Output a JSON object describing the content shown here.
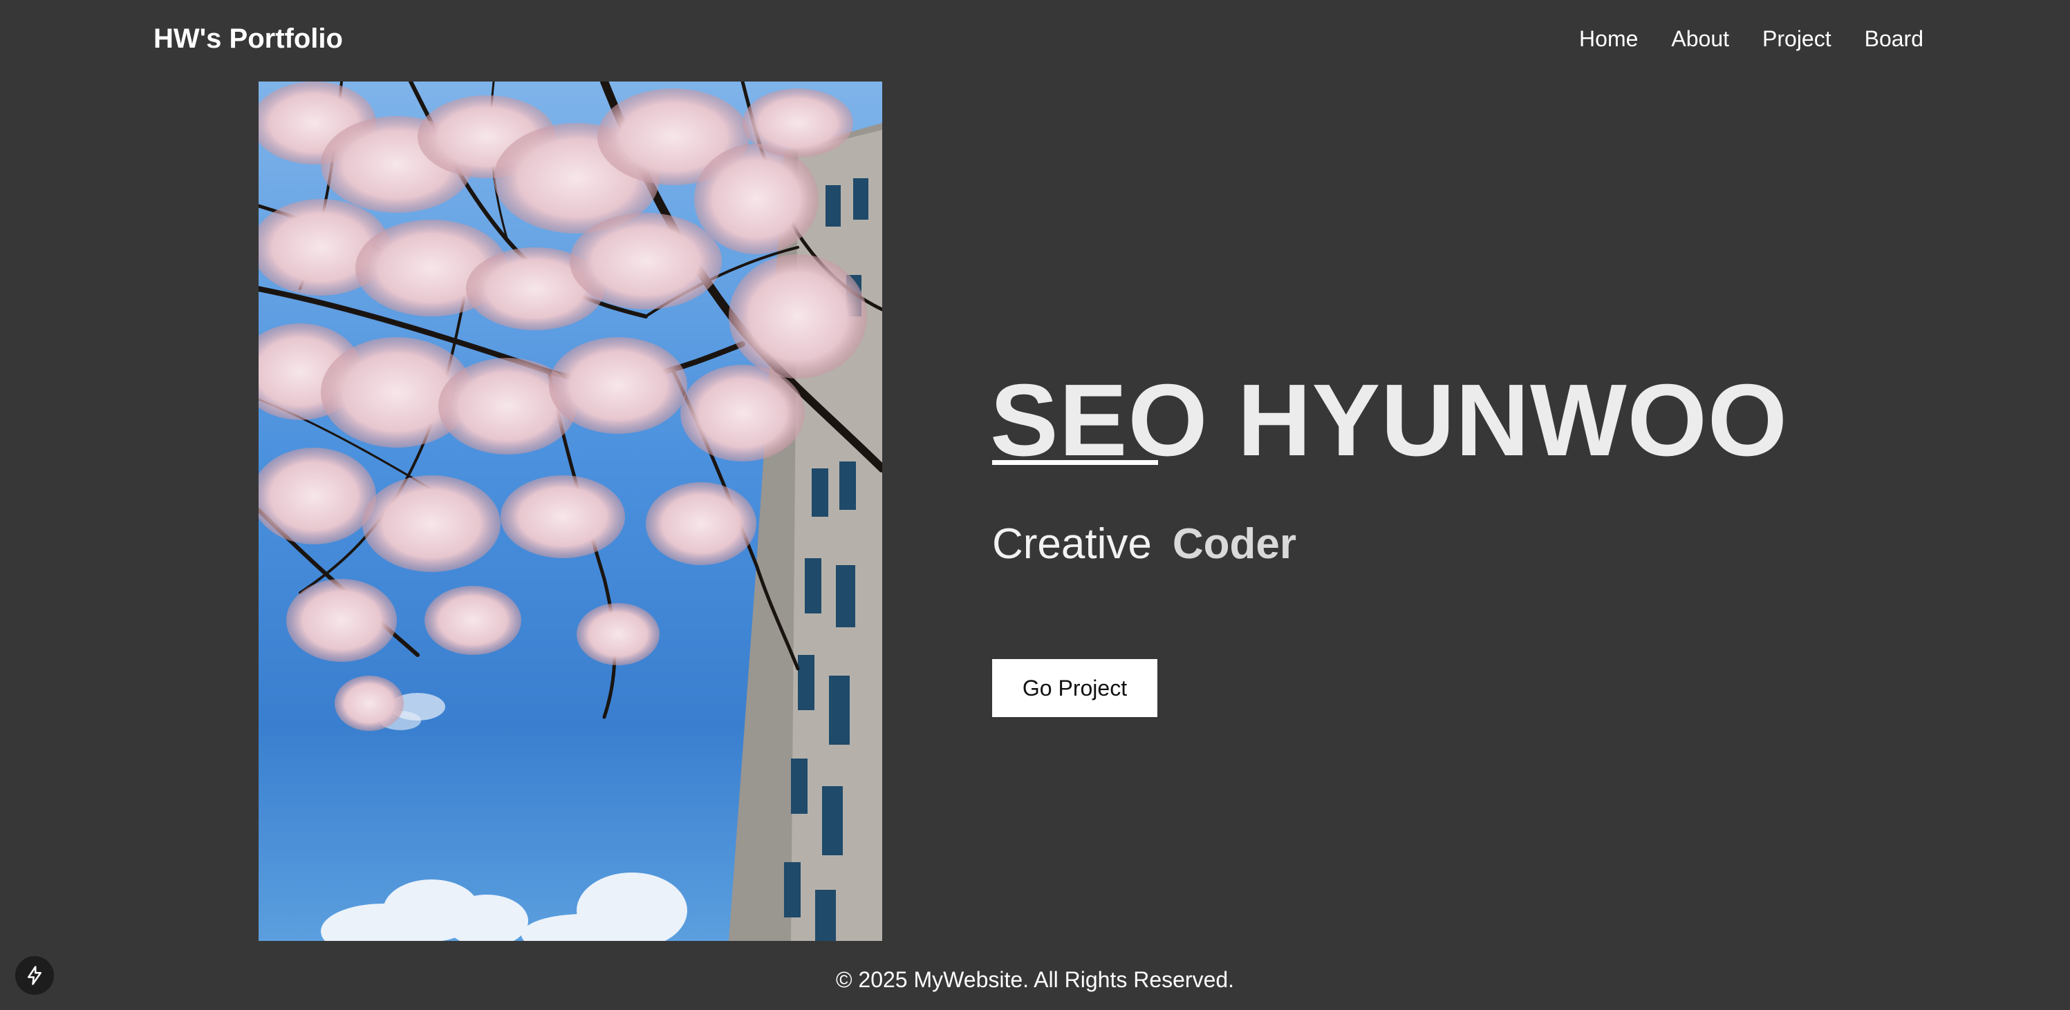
{
  "header": {
    "brand": "HW's Portfolio",
    "nav": [
      {
        "label": "Home"
      },
      {
        "label": "About"
      },
      {
        "label": "Project"
      },
      {
        "label": "Board"
      }
    ]
  },
  "hero": {
    "name": "SEO HYUNWOO",
    "role_word_1": "Creative",
    "role_word_2": "Coder",
    "cta_label": "Go Project",
    "photo_icon": "cherry-blossom-photo"
  },
  "footer": {
    "copyright": "© 2025 MyWebsite. All Rights Reserved."
  },
  "dev_tools": {
    "icon": "lightning-icon"
  },
  "colors": {
    "background": "#373737",
    "text": "#ffffff",
    "hero_name": "#ececec",
    "cta_bg": "#ffffff",
    "cta_text": "#111111"
  }
}
